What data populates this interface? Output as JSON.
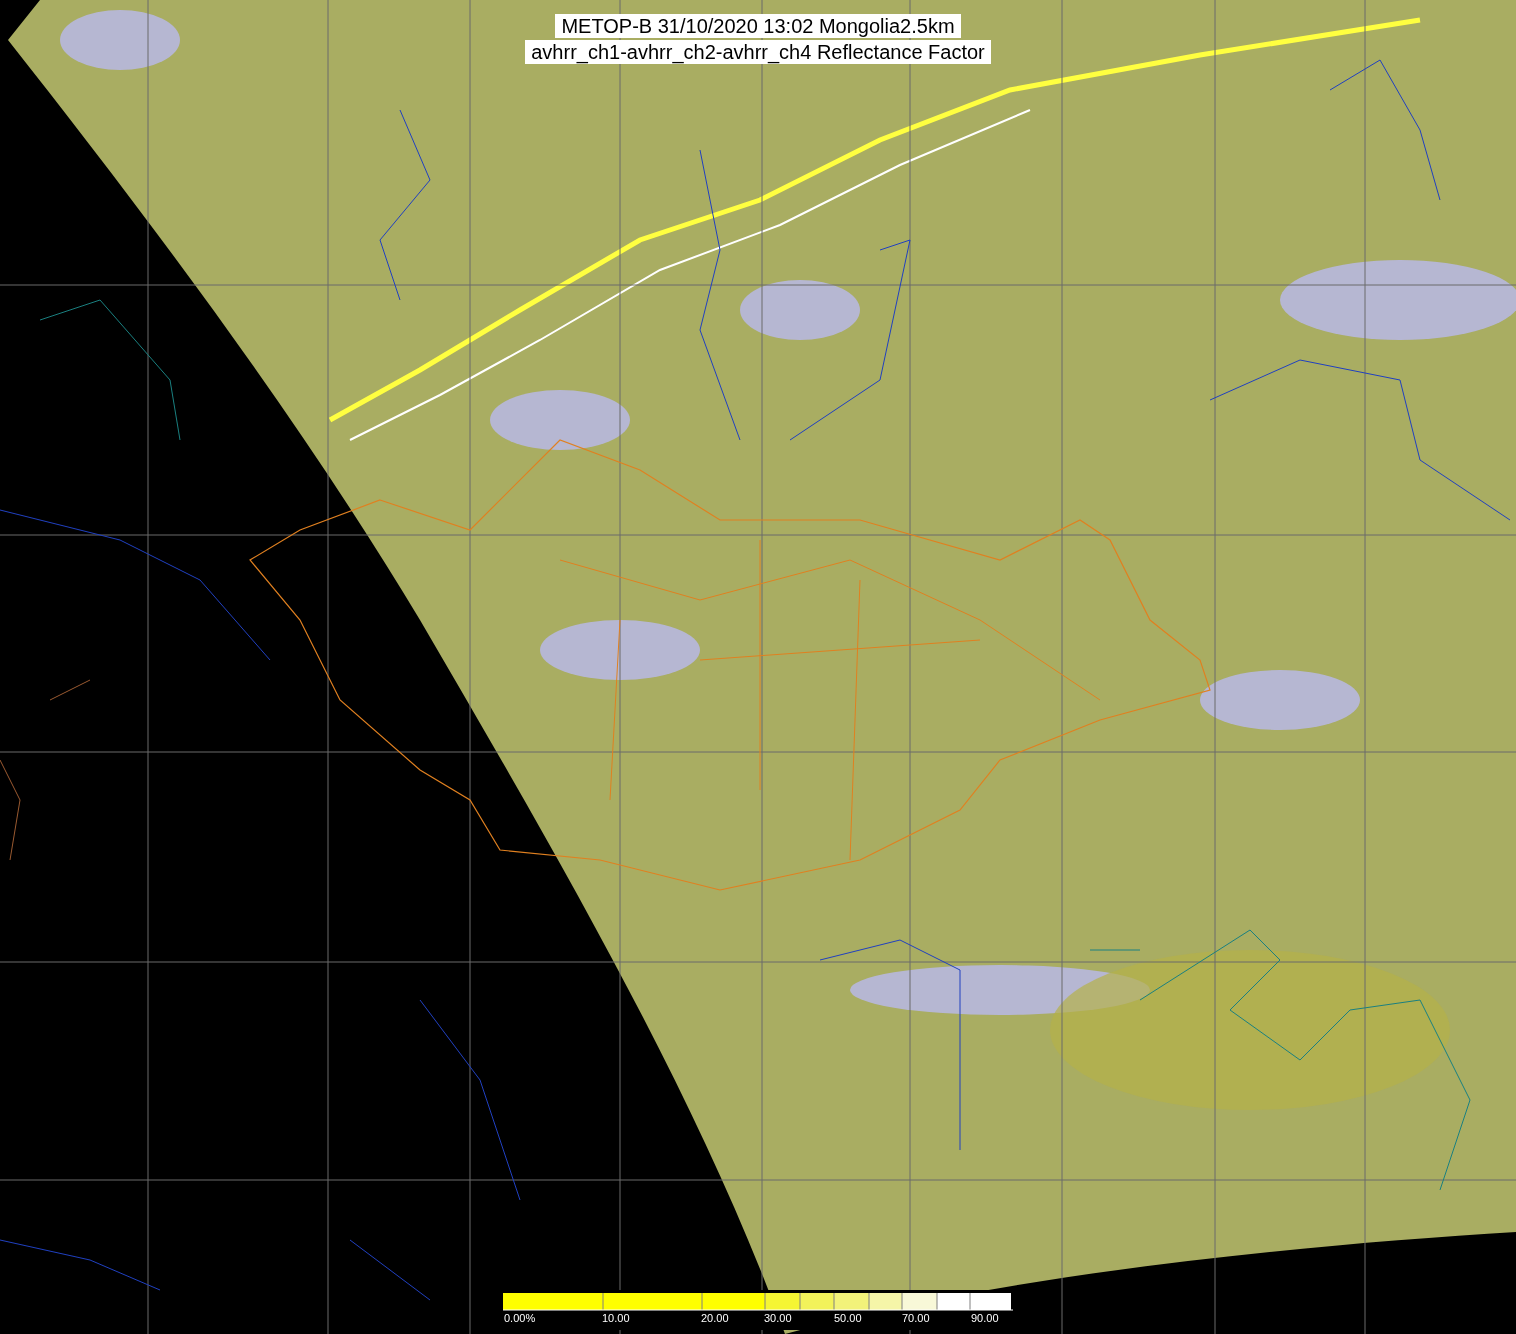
{
  "title": {
    "lines": [
      "METOP-B 31/10/2020 13:02 Mongolia2.5km",
      "avhrr_ch1-avhrr_ch2-avhrr_ch4 Reflectance Factor"
    ]
  },
  "colorbar": {
    "labels": [
      "0.00%",
      "10.00",
      "20.00",
      "30.00",
      "50.00",
      "70.00",
      "90.00"
    ]
  }
}
